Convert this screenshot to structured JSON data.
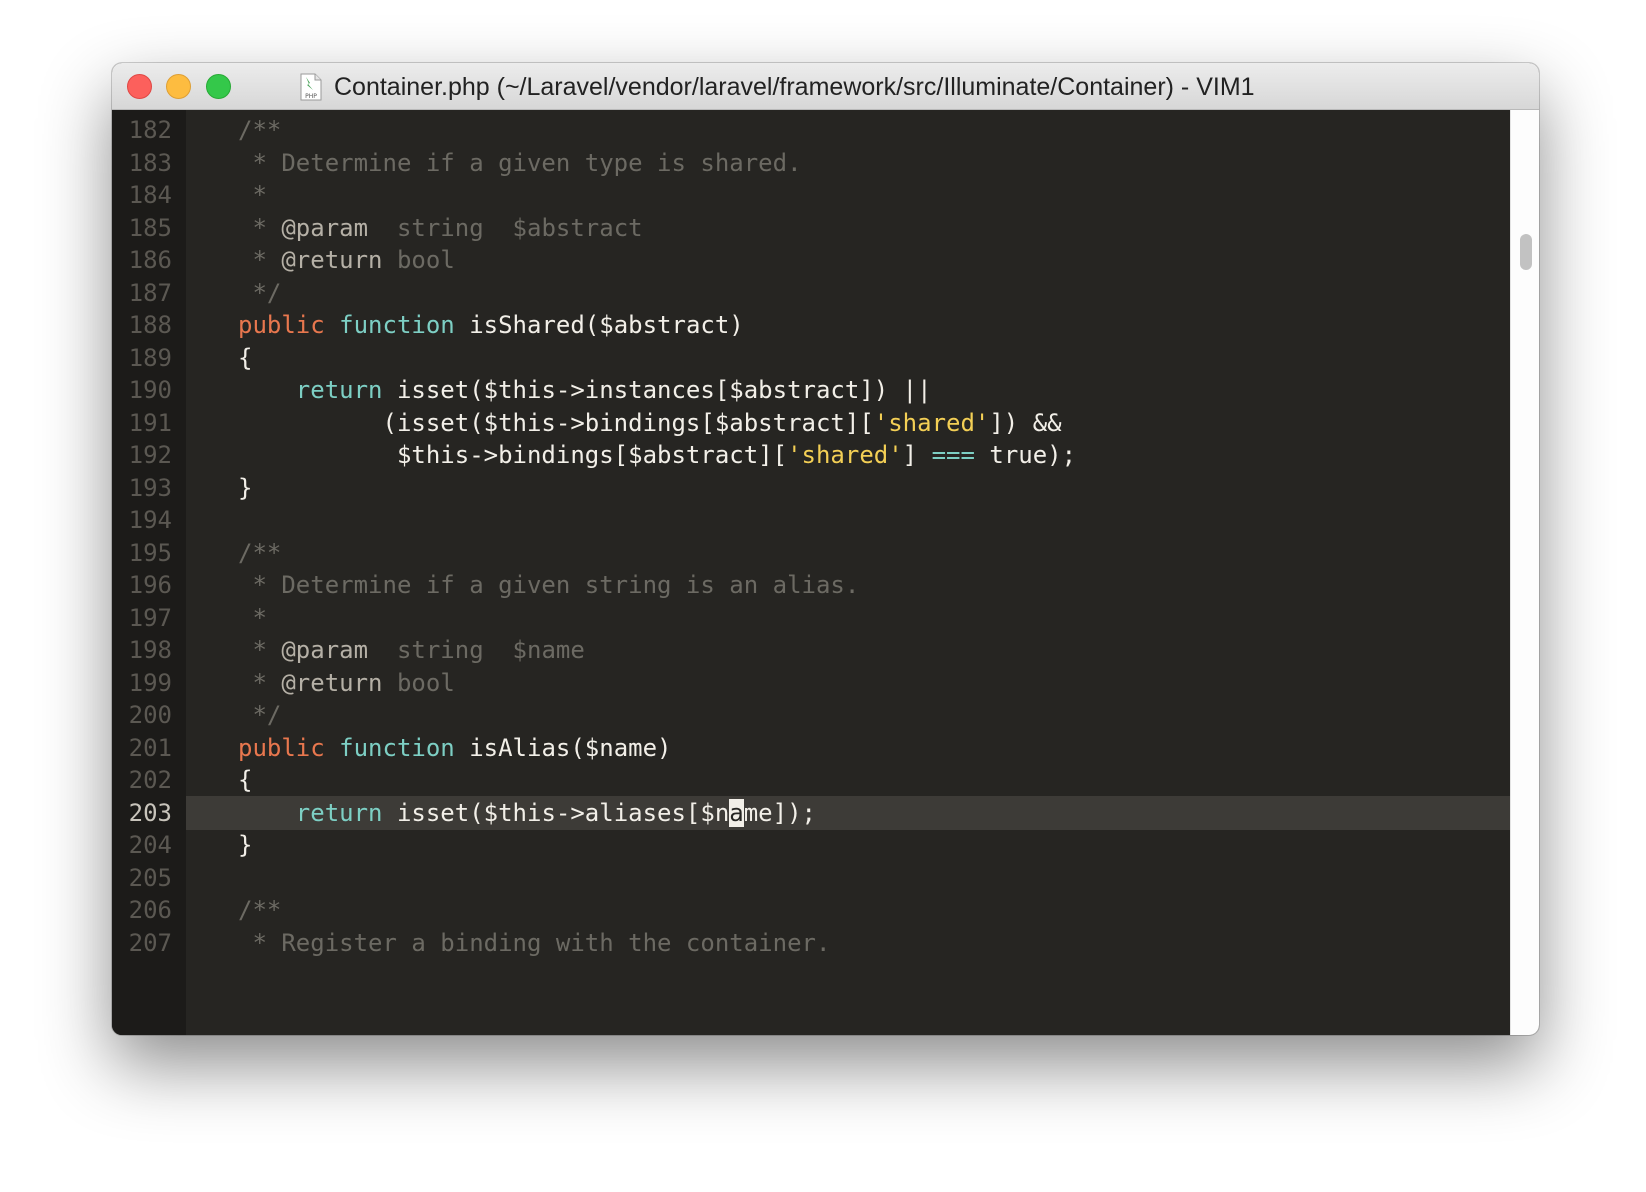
{
  "window": {
    "title": "Container.php (~/Laravel/vendor/laravel/framework/src/Illuminate/Container) - VIM1",
    "file_icon": "php-file-icon",
    "file_icon_label": "PHP"
  },
  "colors": {
    "background": "#262522",
    "gutter": "#1c1b19",
    "line_number": "#5b5852",
    "comment": "#6c6a63",
    "keyword": "#e8774e",
    "function": "#7dcfc4",
    "string": "#f3cf55",
    "text": "#f2efe8",
    "cursorline": "#3d3b37"
  },
  "editor": {
    "cursor_line": 203,
    "lines": [
      {
        "num": "182",
        "tokens": [
          [
            "comment",
            "/**"
          ]
        ]
      },
      {
        "num": "183",
        "tokens": [
          [
            "comment",
            " * Determine if a given type is shared."
          ]
        ]
      },
      {
        "num": "184",
        "tokens": [
          [
            "comment",
            " *"
          ]
        ]
      },
      {
        "num": "185",
        "tokens": [
          [
            "comment",
            " * "
          ],
          [
            "tag",
            "@param"
          ],
          [
            "comment",
            "  string  $abstract"
          ]
        ]
      },
      {
        "num": "186",
        "tokens": [
          [
            "comment",
            " * "
          ],
          [
            "tag",
            "@return"
          ],
          [
            "comment",
            " bool"
          ]
        ]
      },
      {
        "num": "187",
        "tokens": [
          [
            "comment",
            " */"
          ]
        ]
      },
      {
        "num": "188",
        "tokens": [
          [
            "kw",
            "public"
          ],
          [
            "def",
            " "
          ],
          [
            "fn",
            "function"
          ],
          [
            "def",
            " isShared($abstract)"
          ]
        ]
      },
      {
        "num": "189",
        "tokens": [
          [
            "def",
            "{"
          ]
        ]
      },
      {
        "num": "190",
        "tokens": [
          [
            "def",
            "    "
          ],
          [
            "fn",
            "return"
          ],
          [
            "def",
            " isset($this->instances[$abstract]) ||"
          ]
        ]
      },
      {
        "num": "191",
        "tokens": [
          [
            "def",
            "          (isset($this->bindings[$abstract]["
          ],
          [
            "str",
            "'shared'"
          ],
          [
            "def",
            "]) &&"
          ]
        ]
      },
      {
        "num": "192",
        "tokens": [
          [
            "def",
            "           $this->bindings[$abstract]["
          ],
          [
            "str",
            "'shared'"
          ],
          [
            "def",
            "] "
          ],
          [
            "op",
            "==="
          ],
          [
            "def",
            " true);"
          ]
        ]
      },
      {
        "num": "193",
        "tokens": [
          [
            "def",
            "}"
          ]
        ]
      },
      {
        "num": "194",
        "tokens": []
      },
      {
        "num": "195",
        "tokens": [
          [
            "comment",
            "/**"
          ]
        ]
      },
      {
        "num": "196",
        "tokens": [
          [
            "comment",
            " * Determine if a given string is an alias."
          ]
        ]
      },
      {
        "num": "197",
        "tokens": [
          [
            "comment",
            " *"
          ]
        ]
      },
      {
        "num": "198",
        "tokens": [
          [
            "comment",
            " * "
          ],
          [
            "tag",
            "@param"
          ],
          [
            "comment",
            "  string  $name"
          ]
        ]
      },
      {
        "num": "199",
        "tokens": [
          [
            "comment",
            " * "
          ],
          [
            "tag",
            "@return"
          ],
          [
            "comment",
            " bool"
          ]
        ]
      },
      {
        "num": "200",
        "tokens": [
          [
            "comment",
            " */"
          ]
        ]
      },
      {
        "num": "201",
        "tokens": [
          [
            "kw",
            "public"
          ],
          [
            "def",
            " "
          ],
          [
            "fn",
            "function"
          ],
          [
            "def",
            " isAlias($name)"
          ]
        ]
      },
      {
        "num": "202",
        "tokens": [
          [
            "def",
            "{"
          ]
        ]
      },
      {
        "num": "203",
        "tokens": [
          [
            "def",
            "    "
          ],
          [
            "fn",
            "return"
          ],
          [
            "def",
            " isset($this->aliases[$n"
          ],
          [
            "cursor",
            "a"
          ],
          [
            "def",
            "me]);"
          ]
        ]
      },
      {
        "num": "204",
        "tokens": [
          [
            "def",
            "}"
          ]
        ]
      },
      {
        "num": "205",
        "tokens": []
      },
      {
        "num": "206",
        "tokens": [
          [
            "comment",
            "/**"
          ]
        ]
      },
      {
        "num": "207",
        "tokens": [
          [
            "comment",
            " * Register a binding with the container."
          ]
        ]
      }
    ]
  },
  "scrollbar": {
    "position_fraction": 0.14
  }
}
